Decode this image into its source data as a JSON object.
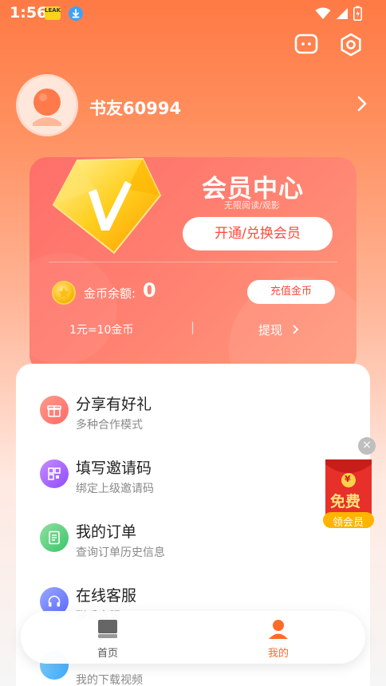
{
  "status_bar": {
    "time": "1:56",
    "badge": "LEAK",
    "icons": [
      "wifi-icon",
      "signal-icon",
      "battery-icon"
    ]
  },
  "header": {
    "icons": [
      "message-icon",
      "settings-icon"
    ]
  },
  "profile": {
    "username": "书友60994"
  },
  "vip": {
    "title": "会员中心",
    "subtitle": "无限阅读/观影",
    "open_button": "开通/兑换会员",
    "coin_label": "金币余额:",
    "coin_value": "0",
    "recharge_button": "充值金币",
    "rate": "1元=10金币",
    "separator": "|",
    "withdraw": "提现"
  },
  "menu": {
    "items": [
      {
        "title": "分享有好礼",
        "desc": "多种合作模式"
      },
      {
        "title": "填写邀请码",
        "desc": "绑定上级邀请码"
      },
      {
        "title": "我的订单",
        "desc": "查询订单历史信息"
      },
      {
        "title": "在线客服",
        "desc": "联系客服"
      },
      {
        "title": "",
        "desc": "我的下载视频"
      }
    ]
  },
  "float_promo": {
    "big": "免费",
    "small": "领会员",
    "currency": "¥",
    "close": "×"
  },
  "bottom_nav": {
    "items": [
      {
        "label": "首页",
        "active": false
      },
      {
        "label": "我的",
        "active": true
      }
    ]
  },
  "colors": {
    "accent": "#ff6a28",
    "vip_red": "#ff4a3b",
    "text_dark": "#222222",
    "text_muted": "#8a8a8a"
  }
}
